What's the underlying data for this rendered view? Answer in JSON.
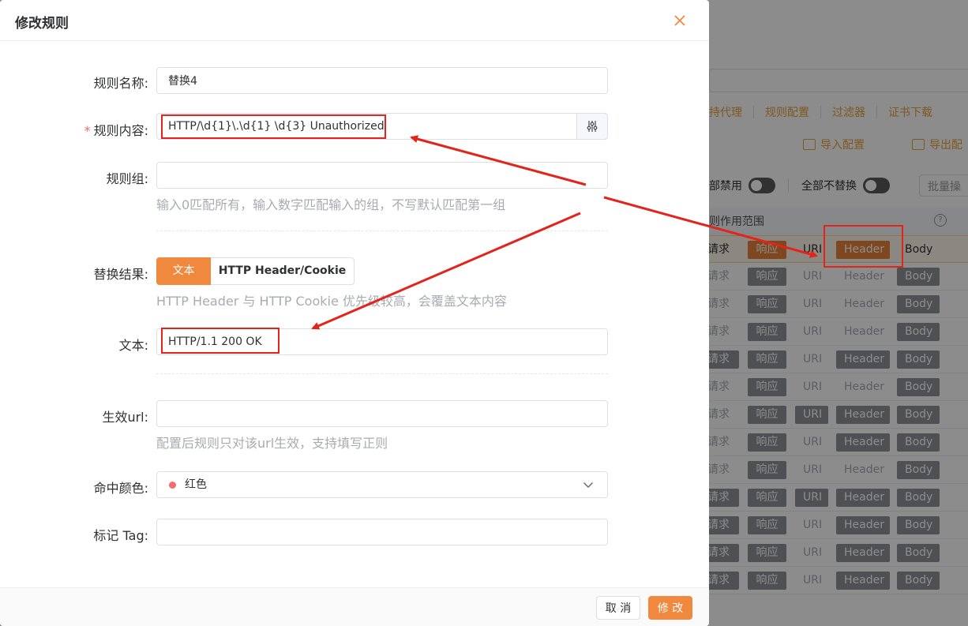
{
  "modal": {
    "title": "修改规则",
    "fields": {
      "name": {
        "label": "规则名称:",
        "value": "替换4"
      },
      "content": {
        "label": "规则内容:",
        "required_mark": "*",
        "value": "HTTP/\\d{1}\\.\\d{1} \\d{3} Unauthorized"
      },
      "group": {
        "label": "规则组:",
        "value": "",
        "hint": "输入0匹配所有，输入数字匹配输入的组，不写默认匹配第一组"
      },
      "result": {
        "label": "替换结果:",
        "options": [
          "文本",
          "HTTP Header/Cookie"
        ],
        "selected": "文本",
        "hint": "HTTP Header 与 HTTP Cookie 优先级较高，会覆盖文本内容"
      },
      "text": {
        "label": "文本:",
        "value": "HTTP/1.1 200 OK"
      },
      "url": {
        "label": "生效url:",
        "value": "",
        "hint": "配置后规则只对该url生效，支持填写正则"
      },
      "color": {
        "label": "命中颜色:",
        "value": "红色",
        "dot_color": "#f56c6c"
      },
      "tag": {
        "label": "标记 Tag:",
        "value": ""
      }
    },
    "footer": {
      "cancel": "取 消",
      "ok": "修 改"
    }
  },
  "background": {
    "nav": [
      "持代理",
      "规则配置",
      "过滤器",
      "证书下载"
    ],
    "actions": {
      "import": "导入配置",
      "export": "导出配"
    },
    "switches": {
      "disable_all": "部禁用",
      "no_replace_all": "全部不替换"
    },
    "batch_button": "批量操",
    "table_header": "则作用范围",
    "help_icon": "?",
    "scope_labels": {
      "request": "请求",
      "response": "响应",
      "uri": "URI",
      "header": "Header",
      "body": "Body"
    },
    "rows": [
      {
        "request": "plain",
        "response": "orange",
        "uri": "plain",
        "header": "orange",
        "body": "plain"
      },
      {
        "request": "off",
        "response": "on",
        "uri": "off",
        "header": "off",
        "body": "on"
      },
      {
        "request": "off",
        "response": "on",
        "uri": "off",
        "header": "off",
        "body": "on"
      },
      {
        "request": "off",
        "response": "on",
        "uri": "off",
        "header": "off",
        "body": "on"
      },
      {
        "request": "on",
        "response": "on",
        "uri": "off",
        "header": "on",
        "body": "on"
      },
      {
        "request": "off",
        "response": "on",
        "uri": "off",
        "header": "off",
        "body": "on"
      },
      {
        "request": "off",
        "response": "on",
        "uri": "on",
        "header": "on",
        "body": "on"
      },
      {
        "request": "off",
        "response": "on",
        "uri": "off",
        "header": "on",
        "body": "on"
      },
      {
        "request": "off",
        "response": "on",
        "uri": "off",
        "header": "off",
        "body": "on"
      },
      {
        "request": "on",
        "response": "on",
        "uri": "on",
        "header": "on",
        "body": "on"
      },
      {
        "request": "on",
        "response": "on",
        "uri": "off",
        "header": "on",
        "body": "on"
      },
      {
        "request": "on",
        "response": "on",
        "uri": "off",
        "header": "on",
        "body": "on"
      },
      {
        "request": "on",
        "response": "on",
        "uri": "off",
        "header": "on",
        "body": "on"
      }
    ]
  },
  "colors": {
    "accent": "#f0883e",
    "annotation": "#e2241b",
    "required": "#f56c6c"
  }
}
